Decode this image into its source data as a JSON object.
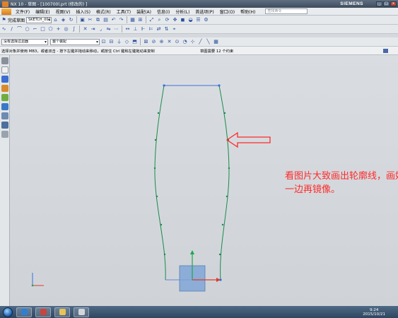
{
  "window": {
    "title": "NX 10 - 草图 - [100700l.prt  (修改的) ]",
    "brand": "SIEMENS",
    "buttons": [
      "_",
      "□",
      "x"
    ]
  },
  "menu": {
    "items": [
      "文件(F)",
      "编辑(E)",
      "视图(V)",
      "插入(S)",
      "格式(R)",
      "工具(T)",
      "装配(A)",
      "信息(I)",
      "分析(L)",
      "首选项(P)",
      "窗口(O)",
      "帮助(H)"
    ],
    "search_placeholder": "查找命令"
  },
  "toolbar1": {
    "finish_sketch": "完成草图",
    "sketch_name": "SKETCH_001"
  },
  "toolbar3": {
    "selection_filter": "没有选择过滤器",
    "scope": "整个装配"
  },
  "status": {
    "prompt": "选择对象并使用 MB3，或者双击 - 按下左键并拖动来移动，或按住 Ctrl 键和左键拖动来复制",
    "constraint": "草图需要 12 个约束"
  },
  "annotation": {
    "text": "看图片大致画出轮廓线，画好一边再镜像。"
  },
  "icons": {
    "window_logo": "nx-icon",
    "start": "start-orb-icon",
    "arrow": "red-arrow-icon"
  },
  "colors": {
    "sketch_curve": "#1b8a4a",
    "top_line": "#3a6fd8",
    "annotation": "#ff2a2a",
    "axis_x": "#e03a2a",
    "axis_y": "#1ea74a",
    "datum_square": "#7aa2d6"
  },
  "taskbar": {
    "time": "9:24",
    "date": "2015/10/21"
  }
}
